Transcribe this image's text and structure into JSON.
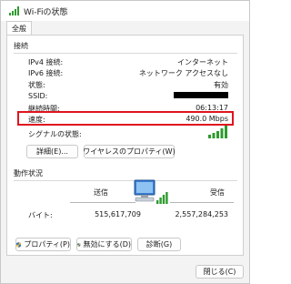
{
  "window": {
    "title": "Wi-Fiの状態"
  },
  "tabs": [
    {
      "label": "全般"
    }
  ],
  "connection": {
    "group_label": "接続",
    "rows": [
      {
        "label": "IPv4 接続:",
        "value": "インターネット"
      },
      {
        "label": "IPv6 接続:",
        "value": "ネットワーク アクセスなし"
      },
      {
        "label": "状態:",
        "value": "有効"
      },
      {
        "label": "SSID:",
        "value": ""
      },
      {
        "label": "継続時間:",
        "value": "06:13:17"
      },
      {
        "label": "速度:",
        "value": "490.0 Mbps"
      }
    ],
    "signal_label": "シグナルの状態:",
    "signal_bars": 5,
    "signal_bars_filled": 5,
    "details_button": "詳細(E)...",
    "wireless_props_button": "ワイヤレスのプロパティ(W)"
  },
  "activity": {
    "group_label": "動作状況",
    "sent_label": "送信",
    "received_label": "受信",
    "bytes_label": "バイト:",
    "bytes_sent": "515,617,709",
    "bytes_received": "2,557,284,253"
  },
  "actions": {
    "properties_button": "プロパティ(P)",
    "disable_button": "無効にする(D)",
    "diagnose_button": "診断(G)"
  },
  "footer": {
    "close_button": "閉じる(C)"
  },
  "colors": {
    "highlight": "#e0141e",
    "signal": "#2e9b2e",
    "accent": "#0067c0"
  }
}
